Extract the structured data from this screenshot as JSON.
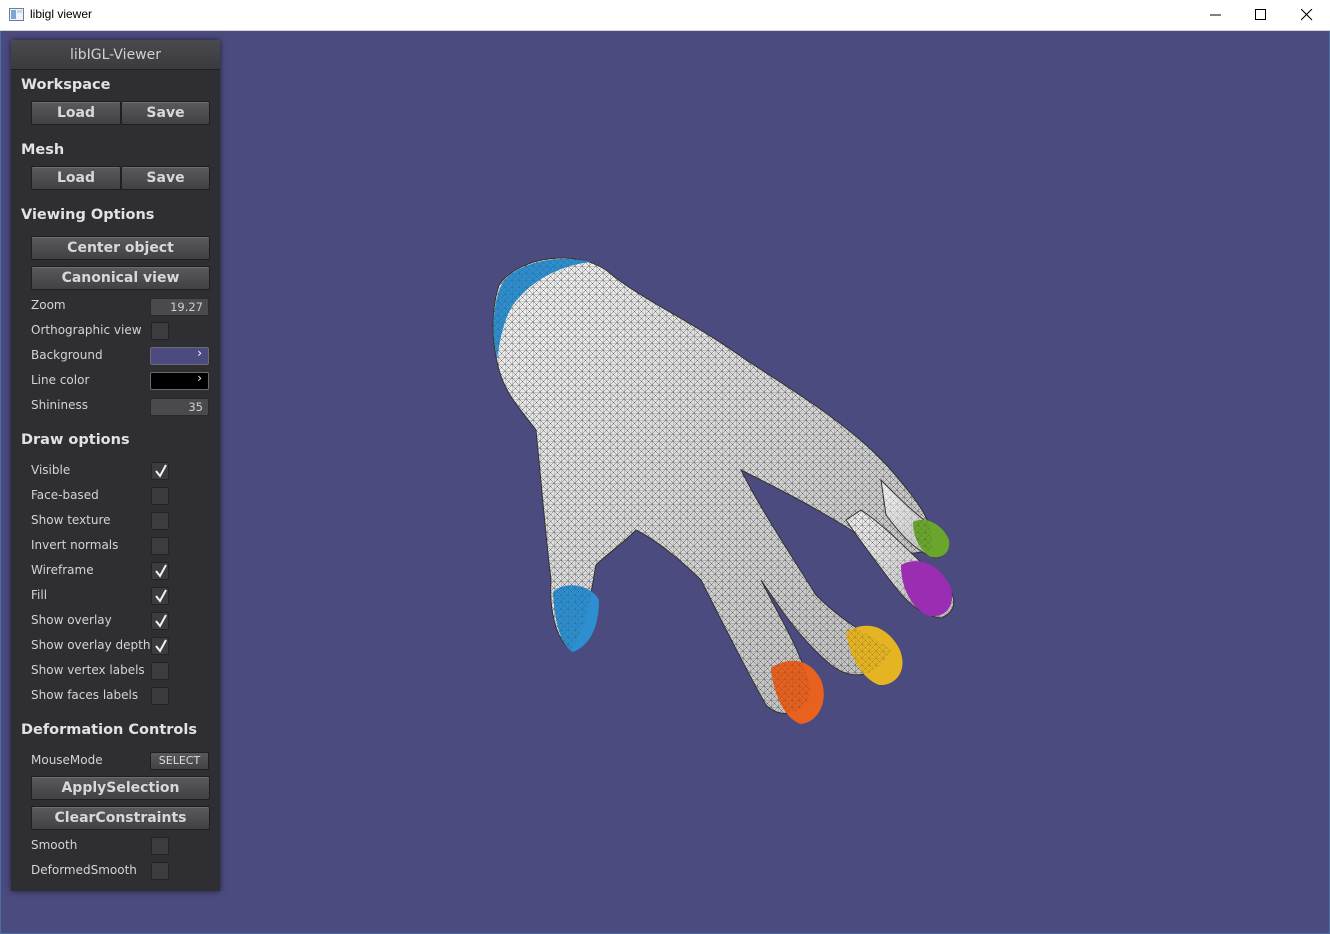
{
  "window": {
    "title": "libigl viewer"
  },
  "panel": {
    "header": "libIGL-Viewer",
    "workspace": {
      "title": "Workspace",
      "load": "Load",
      "save": "Save"
    },
    "mesh": {
      "title": "Mesh",
      "load": "Load",
      "save": "Save"
    },
    "viewing": {
      "title": "Viewing Options",
      "center_object": "Center object",
      "canonical_view": "Canonical view",
      "zoom_label": "Zoom",
      "zoom_value": "19.27",
      "ortho_label": "Orthographic view",
      "ortho_checked": false,
      "background_label": "Background",
      "background_color": "#4c4b7f",
      "line_color_label": "Line color",
      "line_color": "#000000",
      "shininess_label": "Shininess",
      "shininess_value": "35"
    },
    "draw": {
      "title": "Draw options",
      "options": [
        {
          "label": "Visible",
          "checked": true
        },
        {
          "label": "Face-based",
          "checked": false
        },
        {
          "label": "Show texture",
          "checked": false
        },
        {
          "label": "Invert normals",
          "checked": false
        },
        {
          "label": "Wireframe",
          "checked": true
        },
        {
          "label": "Fill",
          "checked": true
        },
        {
          "label": "Show overlay",
          "checked": true
        },
        {
          "label": "Show overlay depth",
          "checked": true
        },
        {
          "label": "Show vertex labels",
          "checked": false
        },
        {
          "label": "Show faces labels",
          "checked": false
        }
      ]
    },
    "deformation": {
      "title": "Deformation Controls",
      "mousemode_label": "MouseMode",
      "mousemode_value": "SELECT",
      "apply_selection": "ApplySelection",
      "clear_constraints": "ClearConstraints",
      "smooth_label": "Smooth",
      "smooth_checked": false,
      "deformed_smooth_label": "DeformedSmooth",
      "deformed_smooth_checked": false
    }
  },
  "viewport": {
    "background": "#4c4b7f",
    "constraint_colors": [
      "#2d8fd0",
      "#e8611f",
      "#e5b423",
      "#9a2db2",
      "#6aa62c"
    ]
  }
}
